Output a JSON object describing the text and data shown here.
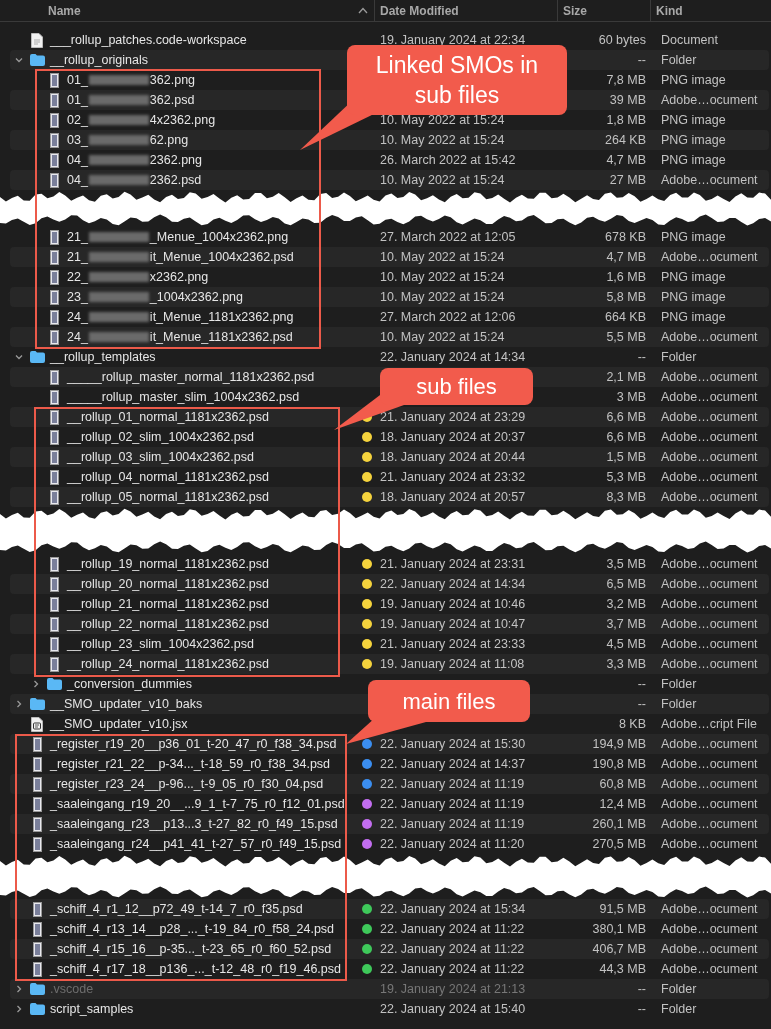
{
  "columns": [
    {
      "label": "Name",
      "sorted": true
    },
    {
      "label": "Date Modified",
      "sorted": false
    },
    {
      "label": "Size",
      "sorted": false
    },
    {
      "label": "Kind",
      "sorted": false
    }
  ],
  "files": [
    {
      "kind": "document",
      "hidden": false,
      "name": "___rollup_patches.code-workspace",
      "date": "19. January 2024 at 22:34",
      "size": "60 bytes",
      "type": "Document"
    },
    {
      "kind": "folder",
      "hidden": false,
      "expanded": true,
      "name": "__rollup_originals",
      "size": "--",
      "type": "Folder",
      "children": [
        {
          "kind": "image",
          "name": "01_",
          "name_end": "362.png",
          "size": "7,8 MB",
          "type": "PNG image"
        },
        {
          "kind": "image",
          "name": "01_",
          "name_end": "362.psd",
          "size": "39 MB",
          "type": "Adobe…ocument"
        },
        {
          "kind": "image",
          "name": "02_",
          "name_end": "4x2362.png",
          "date": "10. May 2022 at 15:24",
          "size": "1,8 MB",
          "type": "PNG image"
        },
        {
          "kind": "image",
          "name": "03_",
          "name_end": "62.png",
          "date": "10. May 2022 at 15:24",
          "size": "264 KB",
          "type": "PNG image"
        },
        {
          "kind": "image",
          "name": "04_",
          "name_end": "2362.png",
          "date": "26. March 2022 at 15:42",
          "size": "4,7 MB",
          "type": "PNG image"
        },
        {
          "kind": "image",
          "name": "04_",
          "name_end": "2362.psd",
          "date": "10. May 2022 at 15:24",
          "size": "27 MB",
          "type": "Adobe…ocument"
        },
        {
          "kind": "tear"
        },
        {
          "kind": "image",
          "name": "21_",
          "name_end": "_Menue_1004x2362.png",
          "date": "27. March 2022 at 12:05",
          "size": "678 KB",
          "type": "PNG image"
        },
        {
          "kind": "image",
          "name": "21_",
          "name_end": "it_Menue_1004x2362.psd",
          "date": "10. May 2022 at 15:24",
          "size": "4,7 MB",
          "type": "Adobe…ocument"
        },
        {
          "kind": "image",
          "name": "22_",
          "name_end": "x2362.png",
          "date": "10. May 2022 at 15:24",
          "size": "1,6 MB",
          "type": "PNG image"
        },
        {
          "kind": "image",
          "name": "23_",
          "name_end": "_1004x2362.png",
          "date": "10. May 2022 at 15:24",
          "size": "5,8 MB",
          "type": "PNG image"
        },
        {
          "kind": "image",
          "name": "24_",
          "name_end": "it_Menue_1181x2362.png",
          "date": "27. March 2022 at 12:06",
          "size": "664 KB",
          "type": "PNG image"
        },
        {
          "kind": "image",
          "name": "24_",
          "name_end": "it_Menue_1181x2362.psd",
          "date": "10. May 2022 at 15:24",
          "size": "5,5 MB",
          "type": "Adobe…ocument"
        }
      ]
    },
    {
      "kind": "folder",
      "hidden": false,
      "expanded": true,
      "name": "__rollup_templates",
      "date": "22. January 2024 at 14:34",
      "size": "--",
      "type": "Folder",
      "children": [
        {
          "kind": "image",
          "name": "_____rollup_master_normal_1181x2362.psd",
          "size": "2,1 MB",
          "type": "Adobe…ocument"
        },
        {
          "kind": "image",
          "name": "_____rollup_master_slim_1004x2362.psd",
          "size": "3 MB",
          "type": "Adobe…ocument"
        },
        {
          "kind": "image",
          "name": "__rollup_01_normal_1181x2362.psd",
          "color": "#f5d33d",
          "date": "21. January 2024 at 23:29",
          "size": "6,6 MB",
          "type": "Adobe…ocument"
        },
        {
          "kind": "image",
          "name": "__rollup_02_slim_1004x2362.psd",
          "color": "#f5d33d",
          "date": "18. January 2024 at 20:37",
          "size": "6,6 MB",
          "type": "Adobe…ocument"
        },
        {
          "kind": "image",
          "name": "__rollup_03_slim_1004x2362.psd",
          "color": "#f5d33d",
          "date": "18. January 2024 at 20:44",
          "size": "1,5 MB",
          "type": "Adobe…ocument"
        },
        {
          "kind": "image",
          "name": "__rollup_04_normal_1181x2362.psd",
          "color": "#f5d33d",
          "date": "21. January 2024 at 23:32",
          "size": "5,3 MB",
          "type": "Adobe…ocument"
        },
        {
          "kind": "image",
          "name": "__rollup_05_normal_1181x2362.psd",
          "color": "#f5d33d",
          "date": "18. January 2024 at 20:57",
          "size": "8,3 MB",
          "type": "Adobe…ocument"
        },
        {
          "kind": "tear"
        },
        {
          "kind": "image",
          "name": "__rollup_19_normal_1181x2362.psd",
          "color": "#f5d33d",
          "date": "21. January 2024 at 23:31",
          "size": "3,5 MB",
          "type": "Adobe…ocument"
        },
        {
          "kind": "image",
          "name": "__rollup_20_normal_1181x2362.psd",
          "color": "#f5d33d",
          "date": "22. January 2024 at 14:34",
          "size": "6,5 MB",
          "type": "Adobe…ocument"
        },
        {
          "kind": "image",
          "name": "__rollup_21_normal_1181x2362.psd",
          "color": "#f5d33d",
          "date": "19. January 2024 at 10:46",
          "size": "3,2 MB",
          "type": "Adobe…ocument"
        },
        {
          "kind": "image",
          "name": "__rollup_22_normal_1181x2362.psd",
          "color": "#f5d33d",
          "date": "19. January 2024 at 10:47",
          "size": "3,7 MB",
          "type": "Adobe…ocument"
        },
        {
          "kind": "image",
          "name": "__rollup_23_slim_1004x2362.psd",
          "color": "#f5d33d",
          "date": "21. January 2024 at 23:33",
          "size": "4,5 MB",
          "type": "Adobe…ocument"
        },
        {
          "kind": "image",
          "name": "__rollup_24_normal_1181x2362.psd",
          "color": "#f5d33d",
          "date": "19. January 2024 at 11:08",
          "size": "3,3 MB",
          "type": "Adobe…ocument"
        },
        {
          "kind": "folder",
          "expanded": false,
          "name": "_conversion_dummies",
          "size": "--",
          "type": "Folder"
        }
      ]
    },
    {
      "kind": "folder",
      "hidden": false,
      "expanded": false,
      "name": "__SMO_updater_v10_baks",
      "size": "--",
      "type": "Folder"
    },
    {
      "kind": "script",
      "hidden": false,
      "name": "__SMO_updater_v10.jsx",
      "size": "8 KB",
      "type": "Adobe…cript File"
    },
    {
      "kind": "image",
      "hidden": false,
      "name": "_register_r19_20__p36_01_t-20_47_r0_f38_34.psd",
      "color": "#3b8ef0",
      "date": "22. January 2024 at 15:30",
      "size": "194,9 MB",
      "type": "Adobe…ocument"
    },
    {
      "kind": "image",
      "hidden": false,
      "name": "_register_r21_22__p-34..._t-18_59_r0_f38_34.psd",
      "color": "#3b8ef0",
      "date": "22. January 2024 at 14:37",
      "size": "190,8 MB",
      "type": "Adobe…ocument"
    },
    {
      "kind": "image",
      "hidden": false,
      "name": "_register_r23_24__p-96..._t-9_05_r0_f30_04.psd",
      "color": "#3b8ef0",
      "date": "22. January 2024 at 11:19",
      "size": "60,8 MB",
      "type": "Adobe…ocument"
    },
    {
      "kind": "image",
      "hidden": false,
      "name": "_saaleingang_r19_20__...9_1_t-7_75_r0_f12_01.psd",
      "color": "#c36ef0",
      "date": "22. January 2024 at 11:19",
      "size": "12,4 MB",
      "type": "Adobe…ocument"
    },
    {
      "kind": "image",
      "hidden": false,
      "name": "_saaleingang_r23__p13...3_t-27_82_r0_f49_15.psd",
      "color": "#c36ef0",
      "date": "22. January 2024 at 11:19",
      "size": "260,1 MB",
      "type": "Adobe…ocument"
    },
    {
      "kind": "image",
      "hidden": false,
      "name": "_saaleingang_r24__p41_41_t-27_57_r0_f49_15.psd",
      "color": "#c36ef0",
      "date": "22. January 2024 at 11:20",
      "size": "270,5 MB",
      "type": "Adobe…ocument"
    },
    {
      "kind": "tear"
    },
    {
      "kind": "image",
      "hidden": false,
      "name": "_schiff_4_r1_12__p72_49_t-14_7_r0_f35.psd",
      "color": "#3ec95a",
      "date": "22. January 2024 at 15:34",
      "size": "91,5 MB",
      "type": "Adobe…ocument"
    },
    {
      "kind": "image",
      "hidden": false,
      "name": "_schiff_4_r13_14__p28_..._t-19_84_r0_f58_24.psd",
      "color": "#3ec95a",
      "date": "22. January 2024 at 11:22",
      "size": "380,1 MB",
      "type": "Adobe…ocument"
    },
    {
      "kind": "image",
      "hidden": false,
      "name": "_schiff_4_r15_16__p-35..._t-23_65_r0_f60_52.psd",
      "color": "#3ec95a",
      "date": "22. January 2024 at 11:22",
      "size": "406,7 MB",
      "type": "Adobe…ocument"
    },
    {
      "kind": "image",
      "hidden": false,
      "name": "_schiff_4_r17_18__p136_..._t-12_48_r0_f19_46.psd",
      "color": "#3ec95a",
      "date": "22. January 2024 at 11:22",
      "size": "44,3 MB",
      "type": "Adobe…ocument"
    },
    {
      "kind": "folder",
      "hidden": true,
      "expanded": false,
      "name": ".vscode",
      "date": "19. January 2024 at 21:13",
      "size": "--",
      "type": "Folder"
    },
    {
      "kind": "folder",
      "hidden": false,
      "expanded": false,
      "name": "script_samples",
      "date": "22. January 2024 at 15:40",
      "size": "--",
      "type": "Folder"
    }
  ],
  "callouts": [
    {
      "text": "Linked SMOs in sub files"
    },
    {
      "text": "sub files"
    },
    {
      "text": "main files"
    }
  ]
}
